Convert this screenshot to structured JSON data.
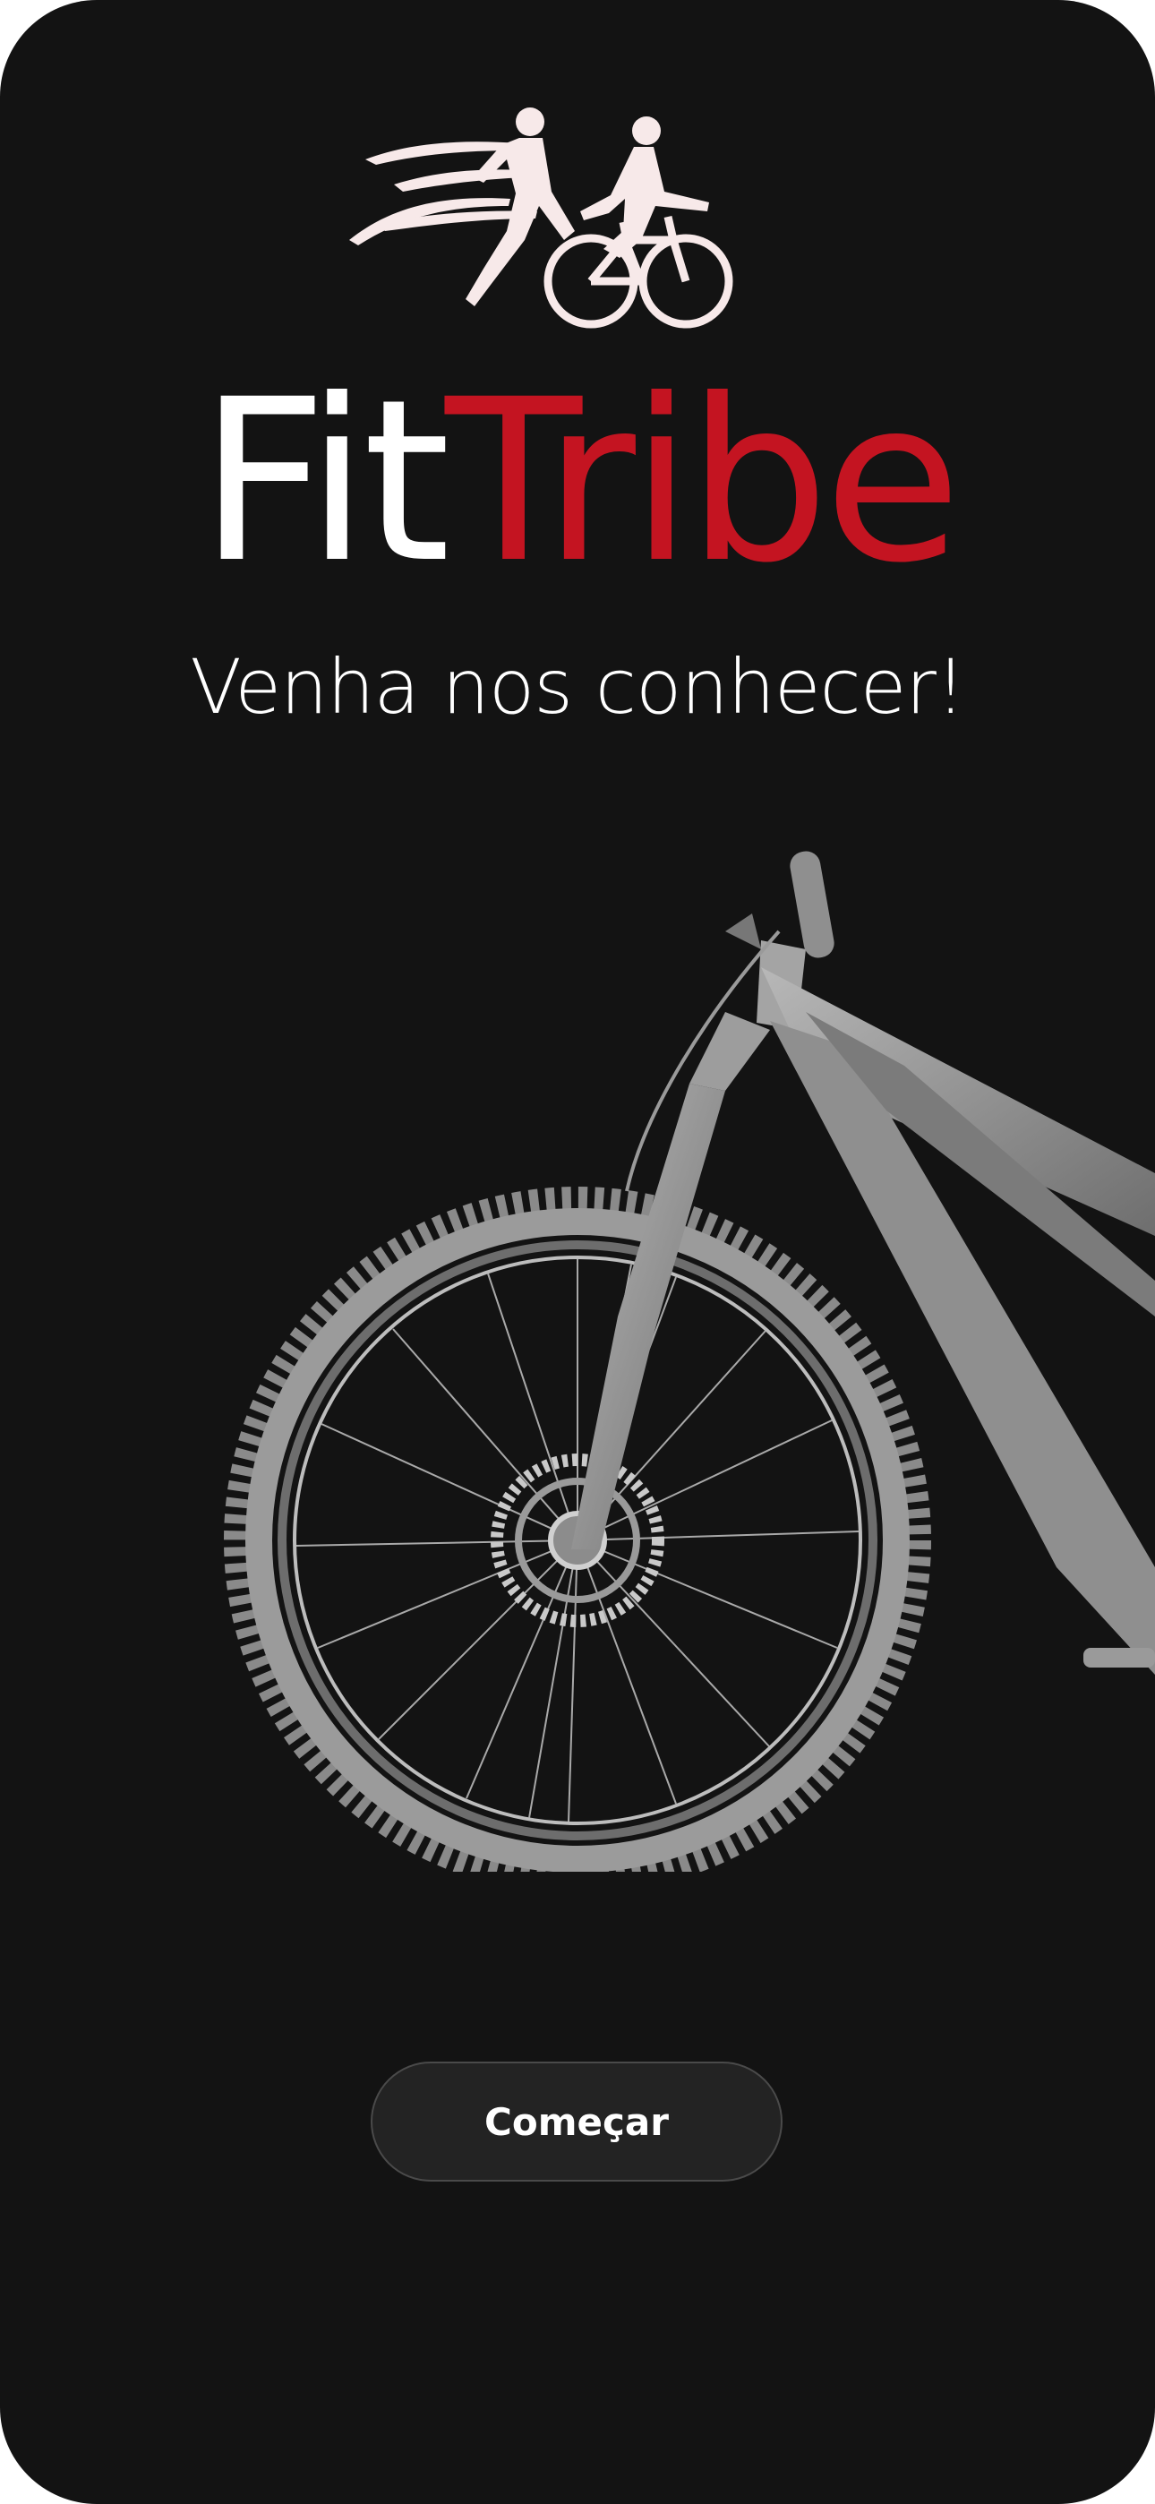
{
  "brand": {
    "part1": "Fit",
    "part2": "Tribe",
    "part1_color": "#ffffff",
    "part2_color": "#c41421",
    "logo_icon": "runner-cyclist-logo"
  },
  "tagline": "Venha nos conhecer!",
  "hero": {
    "image": "mountain-bike-front"
  },
  "actions": {
    "start_label": "Começar"
  },
  "colors": {
    "background": "#131313",
    "accent": "#c41421",
    "button_bg": "#232323"
  }
}
